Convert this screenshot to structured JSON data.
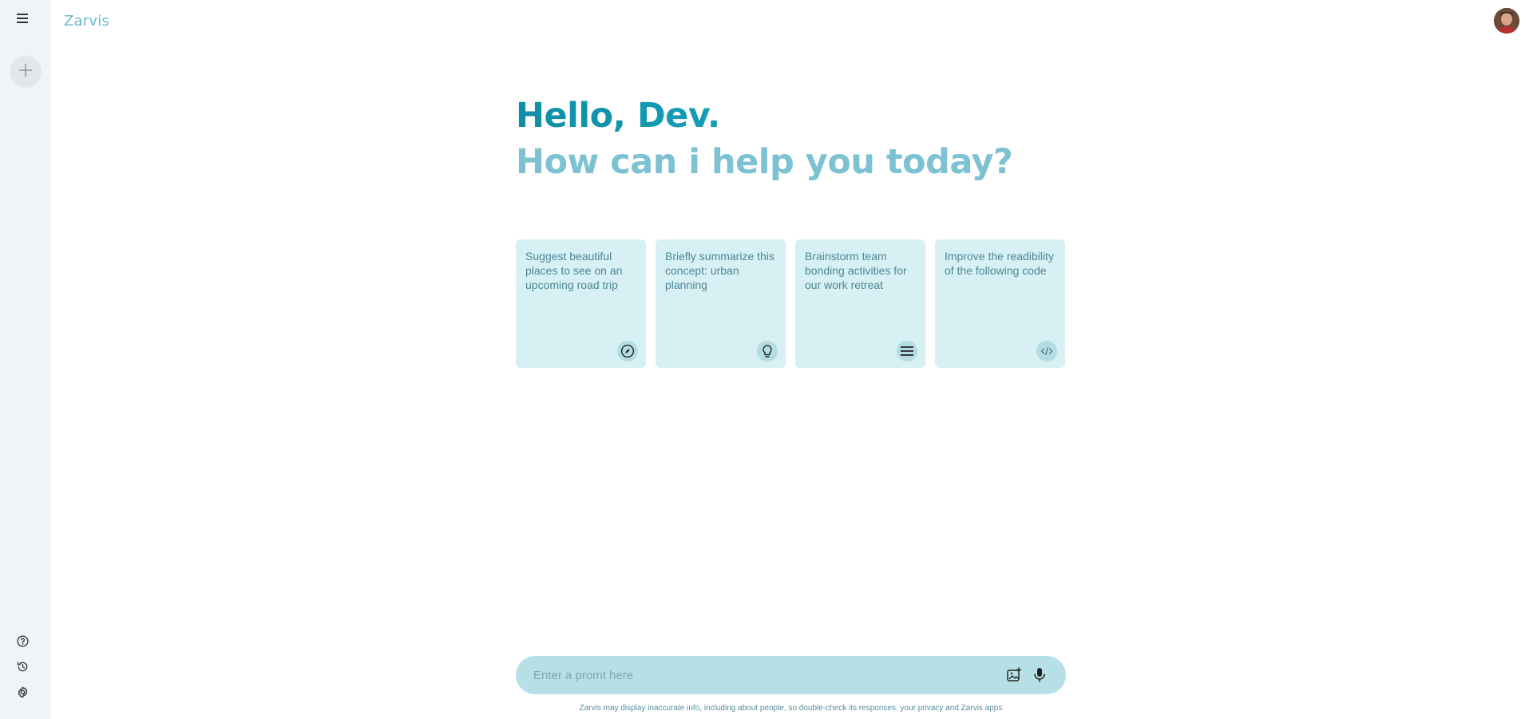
{
  "app": {
    "name": "Zarvis"
  },
  "sidebar": {
    "menu_icon": "menu-icon",
    "new_chat_icon": "plus-icon",
    "bottom": [
      {
        "icon": "help-icon"
      },
      {
        "icon": "history-icon"
      },
      {
        "icon": "gear-icon"
      }
    ]
  },
  "greeting": {
    "hello": "Hello, Dev.",
    "subtitle": "How can i help you today?"
  },
  "cards": [
    {
      "text": "Suggest beautiful places to see on an upcoming road trip",
      "icon": "compass-icon"
    },
    {
      "text": "Briefly summarize this concept: urban planning",
      "icon": "lightbulb-icon"
    },
    {
      "text": "Brainstorm team bonding activities for our work retreat",
      "icon": "list-icon"
    },
    {
      "text": "Improve the readibility of the following code",
      "icon": "code-icon"
    }
  ],
  "prompt": {
    "placeholder": "Enter a promt here",
    "value": "",
    "image_icon": "image-add-icon",
    "mic_icon": "mic-icon"
  },
  "disclaimer": "Zarvis may display inaccurate info, including about people, so double-check its responses. your privacy and Zarvis apps",
  "colors": {
    "brand": "#6db8cc",
    "card_bg": "#d6f0f3",
    "prompt_bg": "#b6e0e5",
    "sidebar_bg": "#f0f4f9"
  }
}
